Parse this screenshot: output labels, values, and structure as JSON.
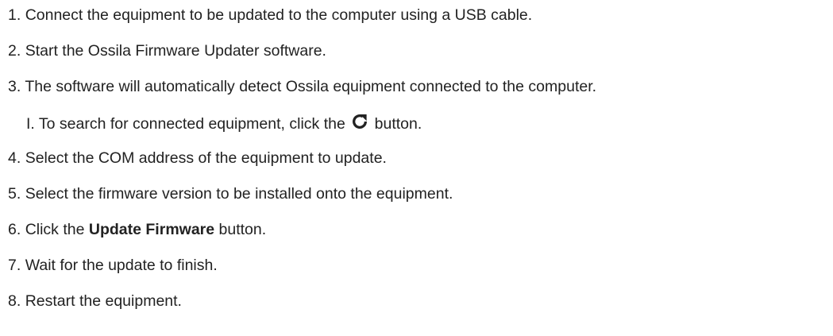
{
  "steps": [
    {
      "num": "1.",
      "text": "Connect the equipment to be updated to the computer using a USB cable."
    },
    {
      "num": "2.",
      "text": "Start the Ossila Firmware Updater software."
    },
    {
      "num": "3.",
      "text": "The software will automatically detect Ossila equipment connected to the computer."
    },
    {
      "num": "4.",
      "text": "Select the COM address of the equipment to update."
    },
    {
      "num": "5.",
      "text": "Select the firmware version to be installed onto the equipment."
    },
    {
      "num": "6.",
      "pre": "Click the ",
      "bold": "Update Firmware",
      "post": " button."
    },
    {
      "num": "7.",
      "text": "Wait for the update to finish."
    },
    {
      "num": "8.",
      "text": "Restart the equipment."
    }
  ],
  "substep": {
    "num": "I.",
    "pre": "To search for connected equipment, click the",
    "icon": "refresh-icon",
    "post": "button."
  }
}
